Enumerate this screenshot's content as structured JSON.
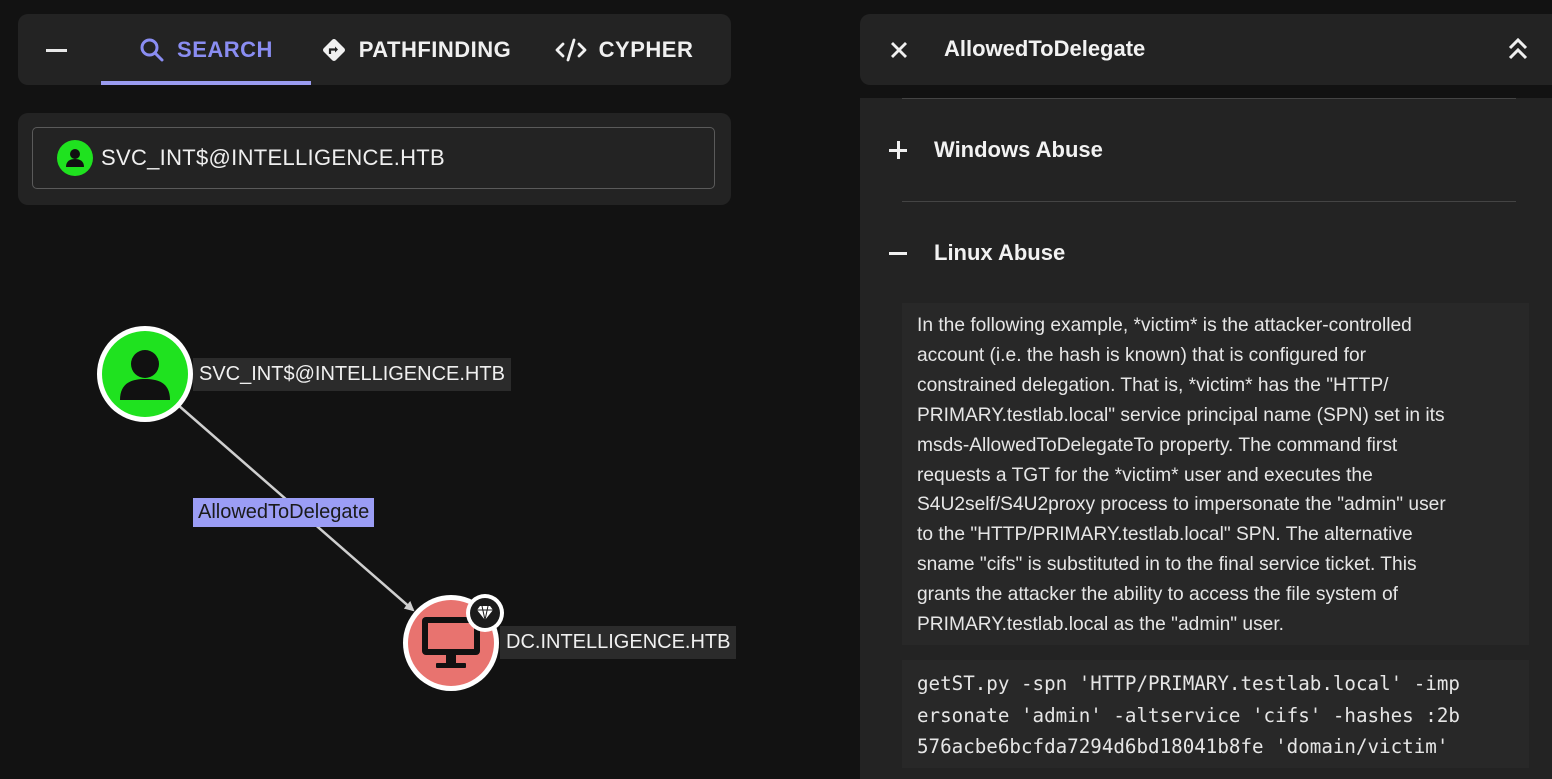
{
  "tabs": [
    {
      "label": "SEARCH",
      "icon": "search-icon",
      "active": true
    },
    {
      "label": "PATHFINDING",
      "icon": "directions-icon",
      "active": false
    },
    {
      "label": "CYPHER",
      "icon": "code-icon",
      "active": false
    }
  ],
  "search": {
    "value": "SVC_INT$@INTELLIGENCE.HTB",
    "icon": "user-icon"
  },
  "graph": {
    "nodes": [
      {
        "label": "SVC_INT$@INTELLIGENCE.HTB",
        "type": "user",
        "color": "#1fe21f"
      },
      {
        "label": "DC.INTELLIGENCE.HTB",
        "type": "computer",
        "color": "#e8736f",
        "badge": "gem-icon"
      }
    ],
    "edge": {
      "label": "AllowedToDelegate",
      "color": "#9b9df5"
    }
  },
  "detail": {
    "title": "AllowedToDelegate",
    "sections": [
      {
        "label": "Windows Abuse",
        "expanded": false
      },
      {
        "label": "Linux Abuse",
        "expanded": true
      }
    ],
    "linux_text_lines": [
      "In the following example, *victim* is the attacker-controlled",
      "account (i.e. the hash is known) that is configured for",
      "constrained delegation. That is, *victim* has the \"HTTP/",
      "PRIMARY.testlab.local\" service principal name (SPN) set in its",
      "msds-AllowedToDelegateTo property. The command first",
      "requests a TGT for the *victim* user and executes the",
      "S4U2self/S4U2proxy process to impersonate the \"admin\" user",
      "to the \"HTTP/PRIMARY.testlab.local\" SPN. The alternative",
      "sname \"cifs\" is substituted in to the final service ticket. This",
      "grants the attacker the ability to access the file system of",
      "PRIMARY.testlab.local as the \"admin\" user."
    ],
    "code_lines": [
      "getST.py -spn 'HTTP/PRIMARY.testlab.local' -imp",
      "ersonate 'admin' -altservice 'cifs' -hashes :2b",
      "576acbe6bcfda7294d6bd18041b8fe 'domain/victim'"
    ]
  },
  "colors": {
    "accent": "#8a8df2",
    "user_node": "#1fe21f",
    "computer_node": "#e8736f"
  }
}
